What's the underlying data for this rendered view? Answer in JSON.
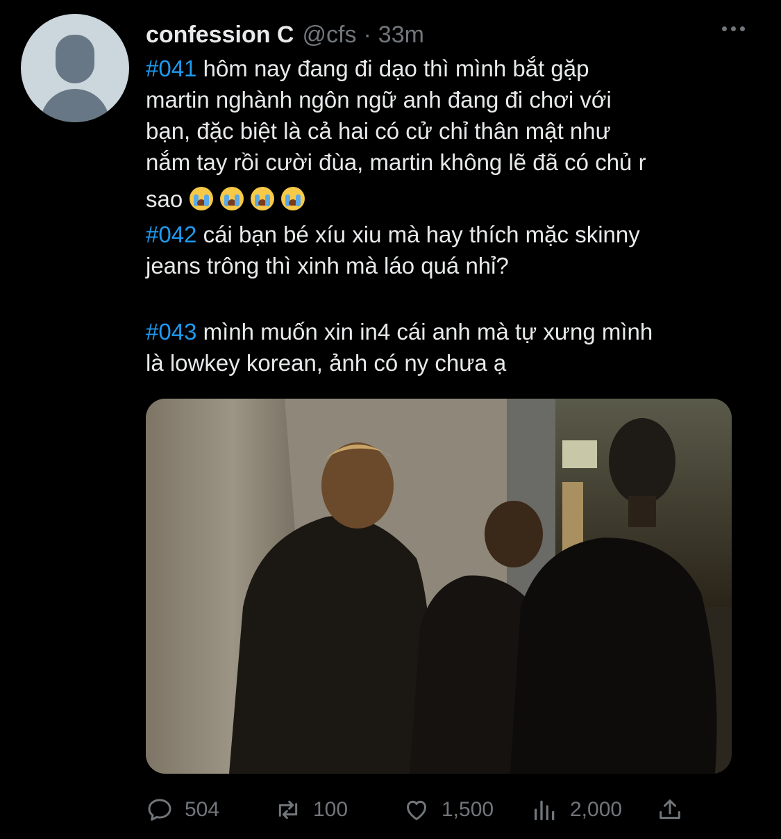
{
  "tweet": {
    "display_name": "confession C",
    "handle": "@cfs",
    "separator": "·",
    "time": "33m",
    "paragraphs": [
      {
        "tag": "#041",
        "lines": [
          " hôm nay đang đi dạo thì mình bắt gặp",
          "martin nghành ngôn ngữ anh đang đi chơi với",
          "bạn, đặc biệt là cả hai có cử chỉ thân mật như",
          "nắm tay rồi cười đùa, martin không lẽ đã có chủ r",
          "sao"
        ]
      },
      {
        "tag": "#042",
        "lines": [
          " cái bạn bé xíu xiu mà hay thích mặc skinny",
          "jeans trông thì xinh mà láo quá nhỉ?"
        ]
      },
      {
        "tag": "#043",
        "lines": [
          " mình muốn xin in4 cái anh mà tự xưng mình",
          "là lowkey korean,  ảnh có ny chưa ạ"
        ]
      }
    ],
    "emoji_after_first": "loudly-crying-face",
    "emoji_count": 4
  },
  "actions": {
    "replies": "504",
    "retweets": "100",
    "likes": "1,500",
    "views": "2,000"
  },
  "colors": {
    "background": "#000000",
    "text": "#e7e9ea",
    "muted": "#71767b",
    "hashtag": "#1d9bf0"
  }
}
